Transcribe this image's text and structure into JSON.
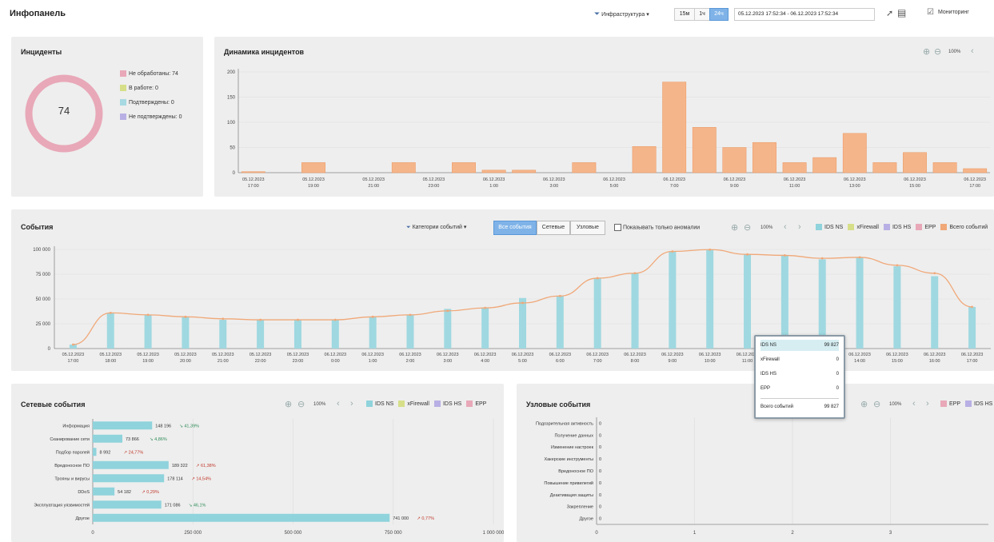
{
  "header": {
    "title": "Инфопанель",
    "filter_label": "Инфраструктура",
    "range_buttons": [
      "15м",
      "1ч",
      "24ч"
    ],
    "date_range": "05.12.2023 17:52:34 - 06.12.2023 17:52:34",
    "right_label": "Мониторинг"
  },
  "incidents": {
    "title": "Инциденты",
    "total": "74",
    "legend": [
      {
        "label": "Не обработаны: 74",
        "color": "#e8a8b8"
      },
      {
        "label": "В работе: 0",
        "color": "#d6df88"
      },
      {
        "label": "Подтверждены: 0",
        "color": "#a6d9e2"
      },
      {
        "label": "Не подтверждены: 0",
        "color": "#b8b0e4"
      }
    ]
  },
  "dynamics": {
    "title": "Динамика инцидентов",
    "zoom": "100%"
  },
  "events": {
    "title": "События",
    "category_filter": "Категории событий",
    "segments": [
      "Все события",
      "Сетевые",
      "Узловые"
    ],
    "anomaly_checkbox": "Показывать только аномалии",
    "zoom": "100%",
    "legend": [
      {
        "label": "IDS NS",
        "color": "#8fd3dc"
      },
      {
        "label": "xFirewall",
        "color": "#d6df88"
      },
      {
        "label": "IDS HS",
        "color": "#b8b0e4"
      },
      {
        "label": "EPP",
        "color": "#e8a8b8"
      },
      {
        "label": "Всего событий",
        "color": "#f0a878"
      }
    ]
  },
  "tooltip": {
    "rows": [
      {
        "label": "IDS NS",
        "value": "99 827"
      },
      {
        "label": "xFirewall",
        "value": "0"
      },
      {
        "label": "IDS HS",
        "value": "0"
      },
      {
        "label": "EPP",
        "value": "0"
      }
    ],
    "total_label": "Всего событий",
    "total_value": "99 827"
  },
  "network_events": {
    "title": "Сетевые события",
    "zoom": "100%",
    "legend": [
      {
        "label": "IDS NS",
        "color": "#8fd3dc"
      },
      {
        "label": "xFirewall",
        "color": "#d6df88"
      },
      {
        "label": "IDS HS",
        "color": "#b8b0e4"
      },
      {
        "label": "EPP",
        "color": "#e8a8b8"
      }
    ]
  },
  "host_events": {
    "title": "Узловые события",
    "zoom": "100%",
    "legend": [
      {
        "label": "EPP",
        "color": "#e8a8b8"
      },
      {
        "label": "IDS HS",
        "color": "#b8b0e4"
      }
    ]
  },
  "chart_data": [
    {
      "type": "bar",
      "title": "Динамика инцидентов",
      "categories": [
        "05.12.2023 17:00",
        "05.12.2023 18:00",
        "05.12.2023 19:00",
        "05.12.2023 20:00",
        "05.12.2023 21:00",
        "05.12.2023 22:00",
        "05.12.2023 23:00",
        "06.12.2023 0:00",
        "06.12.2023 1:00",
        "06.12.2023 2:00",
        "06.12.2023 3:00",
        "06.12.2023 4:00",
        "06.12.2023 5:00",
        "06.12.2023 6:00",
        "06.12.2023 7:00",
        "06.12.2023 8:00",
        "06.12.2023 9:00",
        "06.12.2023 10:00",
        "06.12.2023 11:00",
        "06.12.2023 12:00",
        "06.12.2023 13:00",
        "06.12.2023 14:00",
        "06.12.2023 15:00",
        "06.12.2023 16:00",
        "06.12.2023 17:00"
      ],
      "tick_labels": [
        [
          "05.12.2023",
          "17:00"
        ],
        [
          "05.12.2023",
          "19:00"
        ],
        [
          "05.12.2023",
          "21:00"
        ],
        [
          "05.12.2023",
          "23:00"
        ],
        [
          "06.12.2023",
          "1:00"
        ],
        [
          "06.12.2023",
          "3:00"
        ],
        [
          "06.12.2023",
          "5:00"
        ],
        [
          "06.12.2023",
          "7:00"
        ],
        [
          "06.12.2023",
          "9:00"
        ],
        [
          "06.12.2023",
          "11:00"
        ],
        [
          "06.12.2023",
          "13:00"
        ],
        [
          "06.12.2023",
          "15:00"
        ],
        [
          "06.12.2023",
          "17:00"
        ]
      ],
      "values": [
        2,
        0,
        20,
        0,
        0,
        20,
        0,
        20,
        5,
        5,
        0,
        20,
        0,
        52,
        180,
        90,
        50,
        60,
        20,
        30,
        78,
        20,
        40,
        20,
        8
      ],
      "ylim": [
        0,
        200
      ],
      "yticks": [
        "0",
        "50",
        "100",
        "150",
        "200"
      ],
      "color": "#f5b58a"
    },
    {
      "type": "bar",
      "title": "События",
      "categories": [
        "05.12.2023 17:00",
        "05.12.2023 18:00",
        "05.12.2023 19:00",
        "05.12.2023 20:00",
        "05.12.2023 21:00",
        "05.12.2023 22:00",
        "05.12.2023 23:00",
        "06.12.2023 0:00",
        "06.12.2023 1:00",
        "06.12.2023 2:00",
        "06.12.2023 3:00",
        "06.12.2023 4:00",
        "06.12.2023 5:00",
        "06.12.2023 6:00",
        "06.12.2023 7:00",
        "06.12.2023 8:00",
        "06.12.2023 9:00",
        "06.12.2023 10:00",
        "06.12.2023 11:00",
        "06.12.2023 12:00",
        "06.12.2023 13:00",
        "06.12.2023 14:00",
        "06.12.2023 15:00",
        "06.12.2023 16:00",
        "06.12.2023 17:00"
      ],
      "series": [
        {
          "name": "IDS NS",
          "type": "bar",
          "values": [
            4000,
            36000,
            34000,
            32000,
            29000,
            29000,
            29000,
            29000,
            32000,
            34000,
            40000,
            41000,
            51000,
            53000,
            71000,
            76000,
            98000,
            99827,
            95000,
            94000,
            90000,
            92000,
            83000,
            73000,
            42000
          ]
        },
        {
          "name": "Всего событий",
          "type": "line",
          "values": [
            4000,
            36000,
            34000,
            32000,
            30000,
            29000,
            29000,
            29000,
            32000,
            34000,
            38000,
            41000,
            46000,
            53000,
            71000,
            76000,
            98000,
            99827,
            95000,
            94000,
            91000,
            92000,
            84000,
            76000,
            42000
          ]
        }
      ],
      "ylim": [
        0,
        100000
      ],
      "yticks": [
        "0",
        "25 000",
        "50 000",
        "75 000",
        "100 000"
      ]
    },
    {
      "type": "bar",
      "orientation": "horizontal",
      "title": "Сетевые события",
      "categories": [
        "Информация",
        "Сканирование сети",
        "Подбор паролей",
        "Вредоносное ПО",
        "Трояны и вирусы",
        "DDoS",
        "Эксплуатация уязвимостей",
        "Другое"
      ],
      "values": [
        148196,
        73866,
        8992,
        189322,
        178114,
        54182,
        171086,
        741000
      ],
      "value_labels": [
        "148 196",
        "73 866",
        "8 992",
        "189 322",
        "178 114",
        "54 182",
        "171 086",
        "741 000"
      ],
      "changes": [
        "↘ 41,39%",
        "↘ 4,86%",
        "↗ 24,77%",
        "↗ 61,38%",
        "↗ 14,54%",
        "↗ 0,29%",
        "↘ 46,1%",
        "↗ 0,77%"
      ],
      "xlim": [
        0,
        1000000
      ],
      "xticks": [
        "0",
        "250 000",
        "500 000",
        "750 000",
        "1 000 000"
      ],
      "color": "#8fd3dc"
    },
    {
      "type": "bar",
      "orientation": "horizontal",
      "title": "Узловые события",
      "categories": [
        "Подозрительная активность",
        "Получение данных",
        "Изменение настроек",
        "Хакерские инструменты",
        "Вредоносное ПО",
        "Повышение привилегий",
        "Деактивация защиты",
        "Закрепление",
        "Другое"
      ],
      "values": [
        0,
        0,
        0,
        0,
        0,
        0,
        0,
        0,
        0
      ],
      "xlim": [
        0,
        4
      ],
      "xticks": [
        "0",
        "1",
        "2",
        "3"
      ]
    }
  ]
}
